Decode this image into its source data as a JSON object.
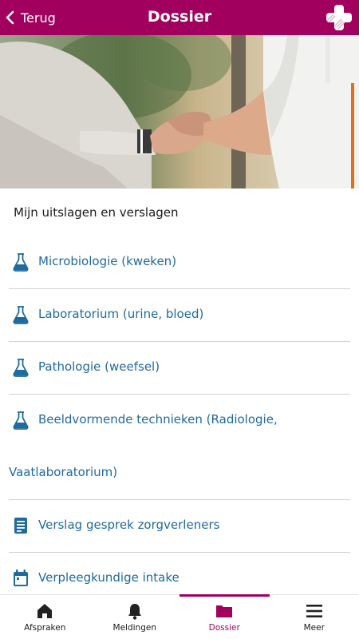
{
  "header": {
    "back_label": "Terug",
    "title": "Dossier",
    "brand_color": "#a1005f"
  },
  "section": {
    "title": "Mijn uitslagen en verslagen"
  },
  "items": [
    {
      "label": "Microbiologie (kweken)",
      "icon": "flask-icon"
    },
    {
      "label": "Laboratorium (urine, bloed)",
      "icon": "flask-icon"
    },
    {
      "label": "Pathologie (weefsel)",
      "icon": "flask-icon"
    },
    {
      "label": "Beeldvormende technieken (Radiologie,",
      "label_continued": "Vaatlaboratorium)",
      "icon": "flask-icon"
    },
    {
      "label": "Verslag gesprek zorgverleners",
      "icon": "document-icon"
    },
    {
      "label": "Verpleegkundige intake",
      "icon": "calendar-icon"
    }
  ],
  "tabs": [
    {
      "label": "Afspraken",
      "icon": "home-icon",
      "active": false
    },
    {
      "label": "Meldingen",
      "icon": "bell-icon",
      "active": false
    },
    {
      "label": "Dossier",
      "icon": "folder-icon",
      "active": true
    },
    {
      "label": "Meer",
      "icon": "menu-icon",
      "active": false
    }
  ],
  "colors": {
    "link": "#1f6a9f",
    "accent": "#a1005f"
  }
}
